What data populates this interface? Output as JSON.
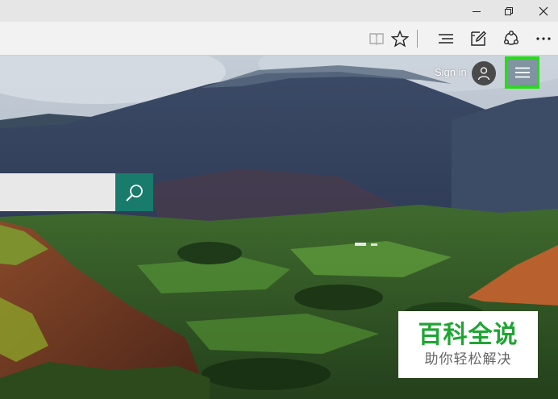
{
  "window": {
    "controls": [
      {
        "name": "minimize",
        "icon": "minimize-icon"
      },
      {
        "name": "restore",
        "icon": "restore-icon"
      },
      {
        "name": "close",
        "icon": "close-icon"
      }
    ]
  },
  "toolbar": {
    "buttons": [
      {
        "icon": "reading-view-icon",
        "enabled": false
      },
      {
        "icon": "favorite-star-icon"
      },
      {
        "icon": "hub-icon"
      },
      {
        "icon": "web-note-icon"
      },
      {
        "icon": "share-icon"
      },
      {
        "icon": "more-icon",
        "label": "···"
      }
    ]
  },
  "header": {
    "signin_label": "Sign in",
    "avatar_icon": "user-icon",
    "menu_icon": "hamburger-menu-icon",
    "highlight_color": "#22e012"
  },
  "search": {
    "placeholder": "",
    "button_icon": "search-icon",
    "button_color": "#197b6c"
  },
  "watermark": {
    "title": "百科全说",
    "subtitle": "助你轻松解决",
    "title_color": "#1fa533"
  }
}
